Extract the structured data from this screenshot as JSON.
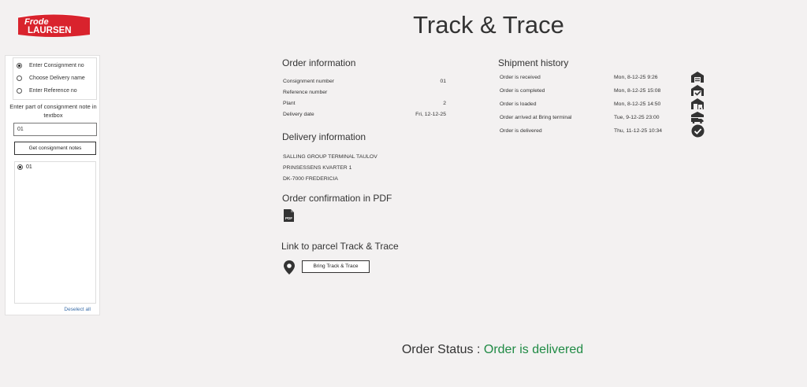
{
  "brand": {
    "line1": "Frode",
    "line2": "LAURSEN",
    "color": "#d9232d"
  },
  "page_title": "Track & Trace",
  "sidebar": {
    "options": [
      {
        "label": "Enter Consignment no",
        "selected": true
      },
      {
        "label": "Choose Delivery name",
        "selected": false
      },
      {
        "label": "Enter Reference no",
        "selected": false
      }
    ],
    "help_text": "Enter part of consignment note in textbox",
    "input_value": "01",
    "get_button": "Get consignment notes",
    "list": [
      {
        "label": "01",
        "selected": true
      }
    ],
    "deselect_all": "Deselect all"
  },
  "order_info": {
    "heading": "Order information",
    "rows": [
      {
        "label": "Consignment number",
        "value": "01"
      },
      {
        "label": "Reference number",
        "value": ""
      },
      {
        "label": "Plant",
        "value": "2"
      },
      {
        "label": "Delivery date",
        "value": "Fri, 12-12-25"
      }
    ]
  },
  "delivery_info": {
    "heading": "Delivery information",
    "lines": [
      "SALLING GROUP TERMINAL TAULOV",
      "PRINSESSENS KVARTER 1",
      "DK-7000 FREDERICIA"
    ]
  },
  "pdf": {
    "heading": "Order confirmation in PDF",
    "icon_label": "PDF"
  },
  "parcel": {
    "heading": "Link to parcel Track & Trace",
    "button": "Bring Track & Trace"
  },
  "shipment_history": {
    "heading": "Shipment history",
    "rows": [
      {
        "event": "Order is received",
        "time": "Mon, 8-12-25 9:26"
      },
      {
        "event": "Order is completed",
        "time": "Mon, 8-12-25 15:08"
      },
      {
        "event": "Order is loaded",
        "time": "Mon, 8-12-25 14:50"
      },
      {
        "event": "Order arrived at Bring terminal",
        "time": "Tue, 9-12-25 23:00"
      },
      {
        "event": "Order is delivered",
        "time": "Thu, 11-12-25 10:34"
      }
    ]
  },
  "order_status": {
    "label": "Order Status :",
    "value": "Order is delivered",
    "value_color": "#1f8a44"
  }
}
